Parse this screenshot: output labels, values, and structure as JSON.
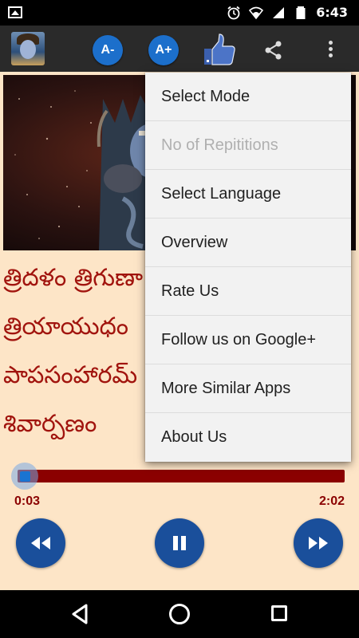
{
  "status_bar": {
    "time": "6:43",
    "icons": [
      "image-icon",
      "alarm-icon",
      "wifi-icon",
      "signal-icon",
      "battery-icon"
    ]
  },
  "toolbar": {
    "font_decrease_label": "A-",
    "font_increase_label": "A+",
    "icons": [
      "app-avatar",
      "like-icon",
      "share-icon",
      "overflow-menu-icon"
    ],
    "accent_color": "#1c6fcb"
  },
  "lyrics": {
    "lines": [
      "త్రిదళం త్రిగుణా",
      "త్రియాయుధం",
      "పాపసంహారమ్",
      "శివార్పణం"
    ],
    "color": "#a1140e"
  },
  "player": {
    "current_time": "0:03",
    "total_time": "2:02",
    "progress_fraction": 0.025,
    "buttons": [
      "rewind-icon",
      "pause-icon",
      "fast-forward-icon"
    ],
    "button_color": "#1a4f9b",
    "seek_color": "#8b0000"
  },
  "menu": {
    "items": [
      {
        "label": "Select Mode",
        "enabled": true
      },
      {
        "label": "No of Repititions",
        "enabled": false
      },
      {
        "label": "Select Language",
        "enabled": true
      },
      {
        "label": "Overview",
        "enabled": true
      },
      {
        "label": "Rate Us",
        "enabled": true
      },
      {
        "label": "Follow us on Google+",
        "enabled": true
      },
      {
        "label": "More Similar Apps",
        "enabled": true
      },
      {
        "label": "About Us",
        "enabled": true
      }
    ]
  },
  "colors": {
    "background": "#fde5c7",
    "toolbar": "#2a2a2a"
  }
}
